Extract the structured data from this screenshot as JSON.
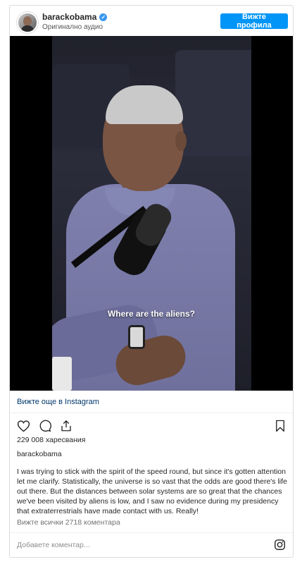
{
  "header": {
    "username": "barackobama",
    "subtitle": "Оригинално аудио",
    "profile_button": "Вижте профила"
  },
  "media": {
    "subtitle_text": "Where are the aliens?"
  },
  "view_more": "Вижте още в Instagram",
  "likes": "229 008 харесвания",
  "caption": {
    "username": "barackobama",
    "text": "I was trying to stick with the spirit of the speed round, but since it's gotten attention let me clarify. Statistically, the universe is so vast that the odds are good there's life out there. But the distances between solar systems are so great that the chances we've been visited by aliens is low, and I saw no evidence during my presidency that extraterrestrials have made contact with us. Really!"
  },
  "comments_link": "Вижте всички 2718 коментара",
  "comment_placeholder": "Добавете коментар...",
  "icons": {
    "like": "heart-icon",
    "comment": "comment-icon",
    "share": "share-icon",
    "save": "bookmark-icon",
    "instagram": "instagram-icon",
    "verified": "verified-badge-icon"
  },
  "colors": {
    "accent": "#0095f6",
    "link": "#00376b",
    "muted": "#737373"
  }
}
